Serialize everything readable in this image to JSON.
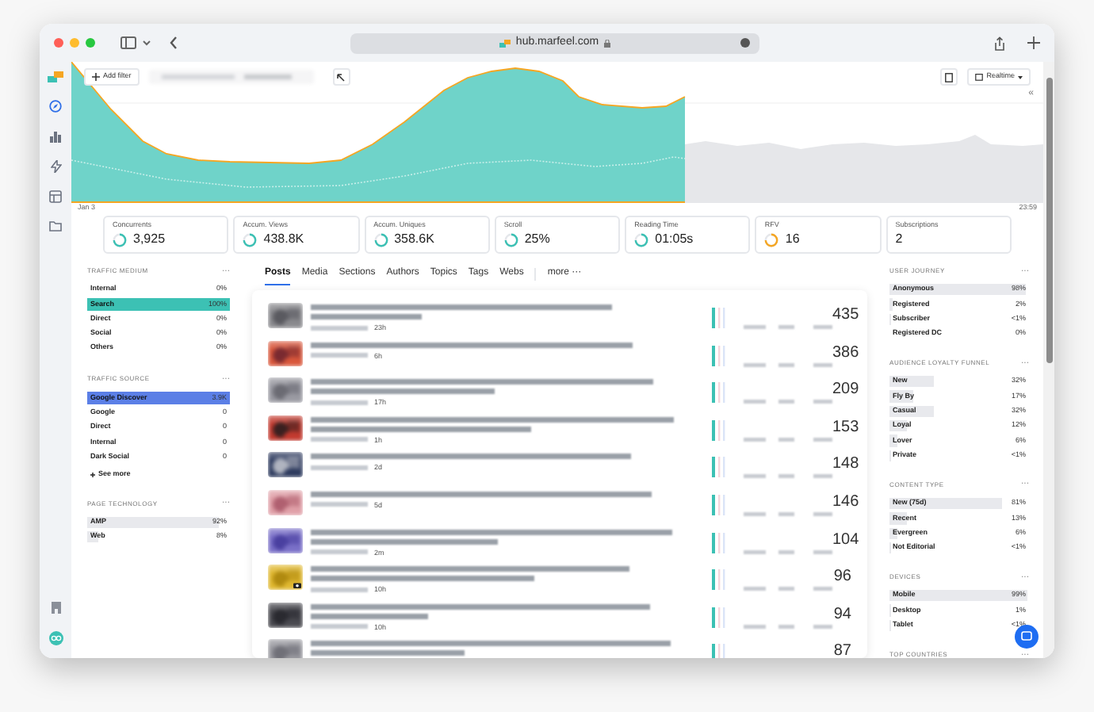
{
  "browser": {
    "url": "hub.marfeel.com"
  },
  "toolbar": {
    "add_filter": "Add filter",
    "realtime": "Realtime",
    "collapse": "«"
  },
  "chart": {
    "start_label": "Jan 3",
    "end_label": "23:59"
  },
  "metrics": [
    {
      "label": "Concurrents",
      "value": "3,925",
      "color": "#3cc1b4"
    },
    {
      "label": "Accum. Views",
      "value": "438.8K",
      "color": "#3cc1b4"
    },
    {
      "label": "Accum. Uniques",
      "value": "358.6K",
      "color": "#3cc1b4"
    },
    {
      "label": "Scroll",
      "value": "25%",
      "color": "#3cc1b4"
    },
    {
      "label": "Reading Time",
      "value": "01:05s",
      "color": "#3cc1b4"
    },
    {
      "label": "RFV",
      "value": "16",
      "color": "#f5a623"
    },
    {
      "label": "Subscriptions",
      "value": "2"
    }
  ],
  "left_panels": [
    {
      "title": "TRAFFIC MEDIUM",
      "menu": "···",
      "rows": [
        {
          "label": "Internal",
          "value": "0%"
        },
        {
          "label": "Search",
          "value": "100%",
          "level": 1,
          "color": "#3cc1b4"
        },
        {
          "label": "Direct",
          "value": "0%"
        },
        {
          "label": "Social",
          "value": "0%"
        },
        {
          "label": "Others",
          "value": "0%"
        }
      ]
    },
    {
      "title": "TRAFFIC SOURCE",
      "menu": "···",
      "see_more": "See more",
      "rows": [
        {
          "label": "Google Discover",
          "value": "3.9K",
          "level": 1,
          "color": "#5b7fe6"
        },
        {
          "label": "Google",
          "value": "0"
        },
        {
          "label": "Direct",
          "value": "0"
        },
        {
          "label": "Internal",
          "value": "0"
        },
        {
          "label": "Dark Social",
          "value": "0"
        }
      ]
    },
    {
      "title": "PAGE TECHNOLOGY",
      "menu": "···",
      "rows": [
        {
          "label": "AMP",
          "value": "92%",
          "level": 0.92
        },
        {
          "label": "Web",
          "value": "8%",
          "level": 0.08
        }
      ]
    }
  ],
  "tabs": [
    {
      "label": "Posts",
      "selected": true
    },
    {
      "label": "Media",
      "selected": false
    },
    {
      "label": "Sections",
      "selected": false
    },
    {
      "label": "Authors",
      "selected": false
    },
    {
      "label": "Topics",
      "selected": false
    },
    {
      "label": "Tags",
      "selected": false
    },
    {
      "label": "Webs",
      "selected": false
    }
  ],
  "more_tab": "more ···",
  "posts": [
    {
      "age": "23h",
      "count": "435",
      "photo_badge": false
    },
    {
      "age": "6h",
      "count": "386",
      "photo_badge": false
    },
    {
      "age": "17h",
      "count": "209",
      "photo_badge": false
    },
    {
      "age": "1h",
      "count": "153",
      "photo_badge": false
    },
    {
      "age": "2d",
      "count": "148",
      "photo_badge": false
    },
    {
      "age": "5d",
      "count": "146",
      "photo_badge": false
    },
    {
      "age": "2m",
      "count": "104",
      "photo_badge": false
    },
    {
      "age": "10h",
      "count": "96",
      "photo_badge": true
    },
    {
      "age": "10h",
      "count": "94",
      "photo_badge": false
    },
    {
      "count": "87",
      "photo_badge": false
    }
  ],
  "right_panels": [
    {
      "title": "USER JOURNEY",
      "menu": "···",
      "rows": [
        {
          "label": "Anonymous",
          "value": "98%",
          "level": 0.98
        },
        {
          "label": "Registered",
          "value": "2%",
          "level": 0.02
        },
        {
          "label": "Subscriber",
          "value": "<1%",
          "level": 0.01
        },
        {
          "label": "Registered DC",
          "value": "0%"
        }
      ]
    },
    {
      "title": "AUDIENCE LOYALTY FUNNEL",
      "menu": "···",
      "rows": [
        {
          "label": "New",
          "value": "32%",
          "level": 0.32
        },
        {
          "label": "Fly By",
          "value": "17%",
          "level": 0.17
        },
        {
          "label": "Casual",
          "value": "32%",
          "level": 0.32
        },
        {
          "label": "Loyal",
          "value": "12%",
          "level": 0.12
        },
        {
          "label": "Lover",
          "value": "6%",
          "level": 0.06
        },
        {
          "label": "Private",
          "value": "<1%",
          "level": 0.01
        }
      ]
    },
    {
      "title": "CONTENT TYPE",
      "menu": "···",
      "rows": [
        {
          "label": "New (75d)",
          "value": "81%",
          "level": 0.81
        },
        {
          "label": "Recent",
          "value": "13%",
          "level": 0.13
        },
        {
          "label": "Evergreen",
          "value": "6%",
          "level": 0.06
        },
        {
          "label": "Not Editorial",
          "value": "<1%",
          "level": 0.01
        }
      ]
    },
    {
      "title": "DEVICES",
      "menu": "···",
      "rows": [
        {
          "label": "Mobile",
          "value": "99%",
          "level": 0.99
        },
        {
          "label": "Desktop",
          "value": "1%",
          "level": 0.01
        },
        {
          "label": "Tablet",
          "value": "<1%",
          "level": 0.01
        }
      ]
    },
    {
      "title": "TOP COUNTRIES",
      "menu": "···"
    }
  ]
}
